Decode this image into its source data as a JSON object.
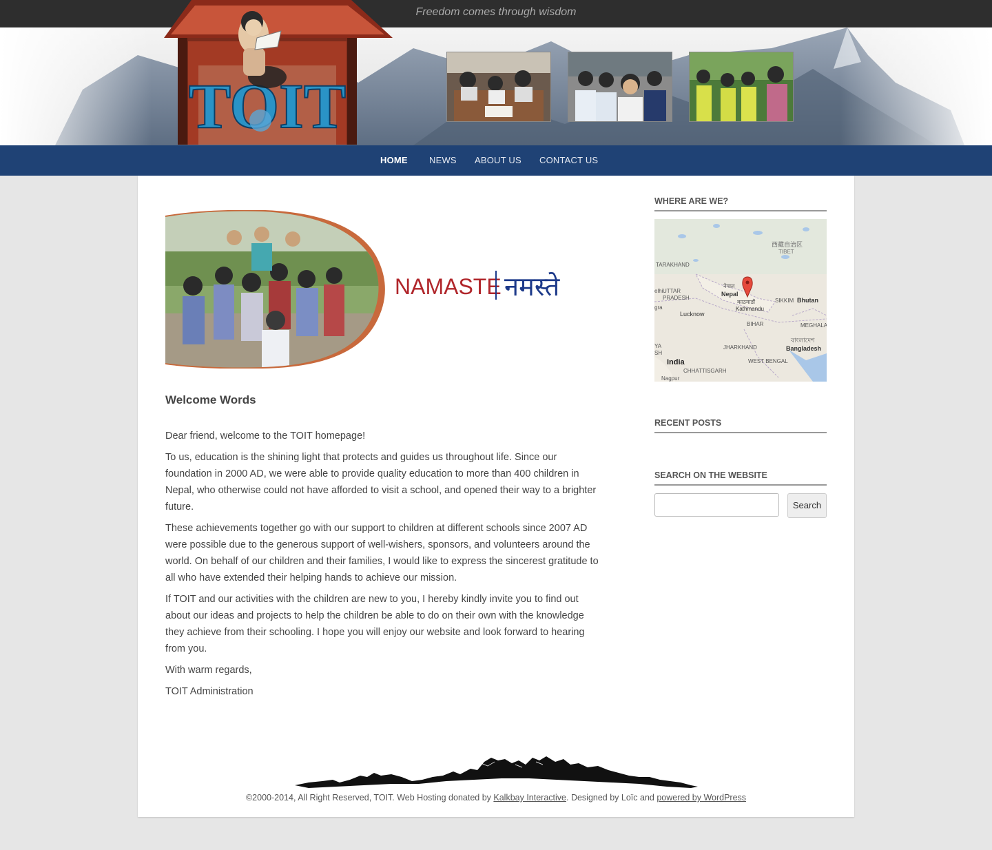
{
  "header": {
    "tagline": "Freedom comes through wisdom",
    "logo_text": "TOIT"
  },
  "nav": {
    "items": [
      {
        "label": "HOME",
        "active": true
      },
      {
        "label": "NEWS",
        "active": false
      },
      {
        "label": "ABOUT US",
        "active": false
      },
      {
        "label": "CONTACT US",
        "active": false
      }
    ]
  },
  "main": {
    "banner": {
      "namaste_en": "NAMASTE",
      "namaste_ne": "नमस्ते"
    },
    "title": "Welcome Words",
    "paragraphs": [
      "Dear friend, welcome to the TOIT homepage!",
      "To us, education is the shining light that protects and guides us throughout life. Since our foundation in 2000 AD, we were able to provide quality education to more than 400 children in Nepal, who otherwise could not have afforded to visit a school, and opened their way to a brighter future.",
      "These achievements together go with our support to children at different schools since 2007 AD were possible due to the generous support of well-wishers, sponsors, and volunteers around the world. On behalf of our children and their families, I would like to express the sincerest gratitude to all who have extended their helping hands to achieve our mission.",
      "If TOIT and our activities with the children are new to you, I hereby kindly invite you to find out about our ideas and projects to help the children be able to do on their own with the knowledge they achieve from their schooling. I hope you will enjoy our website and look forward to hearing from you.",
      "With warm regards,",
      "TOIT Administration"
    ]
  },
  "sidebar": {
    "where_title": "WHERE ARE WE?",
    "map_labels": {
      "tibet_cn": "西藏自治区",
      "tibet": "TIBET",
      "tarakhand": "TARAKHAND",
      "nepal_ne": "नेपाल",
      "nepal": "Nepal",
      "uttar": "UTTAR",
      "pradesh": "PRADESH",
      "elhi": "elhi",
      "kathmandu_ne": "काठमाडौं",
      "kathmandu": "Kathmandu",
      "sikkim": "SIKKIM",
      "bhutan": "Bhutan",
      "gra": "gra",
      "lucknow": "Lucknow",
      "bihar": "BIHAR",
      "meghala": "MEGHALA",
      "ya": "YA",
      "sh": "SH",
      "jharkhand": "JHARKHAND",
      "bangladesh_bn": "বাংলাদেশ",
      "bangladesh": "Bangladesh",
      "india": "India",
      "west_bengal": "WEST BENGAL",
      "chhattisgarh": "CHHATTISGARH",
      "nagpur": "Nagpur"
    },
    "recent_title": "RECENT POSTS",
    "search_title": "SEARCH ON THE WEBSITE",
    "search_placeholder": "",
    "search_button": "Search"
  },
  "footer": {
    "copyright": "©2000-2014, All Right Reserved, TOIT. Web Hosting donated by",
    "host_link": "Kalkbay Interactive",
    "designed": ". Designed by Loïc and",
    "wp_link": "powered by WordPress"
  },
  "colors": {
    "nav_bg": "#1f4275",
    "topbar_bg": "#2e2e2e",
    "page_bg": "#e6e6e6",
    "namaste_red": "#b0262b",
    "namaste_blue": "#1d3a8a"
  }
}
